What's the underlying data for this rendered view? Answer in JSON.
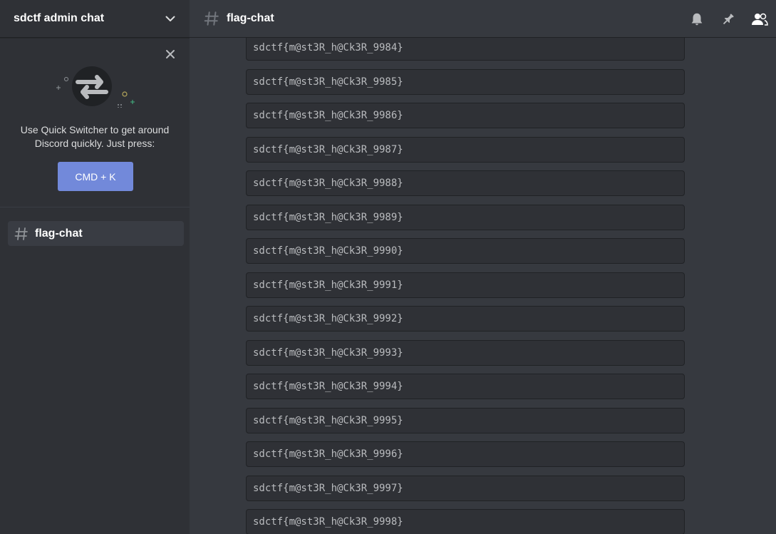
{
  "server": {
    "name": "sdctf admin chat"
  },
  "quick_switcher": {
    "line1": "Use Quick Switcher to get around",
    "line2": "Discord quickly. Just press:",
    "button_label": "CMD + K"
  },
  "channels": [
    {
      "name": "flag-chat",
      "selected": true
    }
  ],
  "header": {
    "channel_name": "flag-chat",
    "icons": [
      "bell-icon",
      "pin-icon",
      "members-icon"
    ]
  },
  "messages": [
    "sdctf{m@st3R_h@Ck3R_9984}",
    "sdctf{m@st3R_h@Ck3R_9985}",
    "sdctf{m@st3R_h@Ck3R_9986}",
    "sdctf{m@st3R_h@Ck3R_9987}",
    "sdctf{m@st3R_h@Ck3R_9988}",
    "sdctf{m@st3R_h@Ck3R_9989}",
    "sdctf{m@st3R_h@Ck3R_9990}",
    "sdctf{m@st3R_h@Ck3R_9991}",
    "sdctf{m@st3R_h@Ck3R_9992}",
    "sdctf{m@st3R_h@Ck3R_9993}",
    "sdctf{m@st3R_h@Ck3R_9994}",
    "sdctf{m@st3R_h@Ck3R_9995}",
    "sdctf{m@st3R_h@Ck3R_9996}",
    "sdctf{m@st3R_h@Ck3R_9997}",
    "sdctf{m@st3R_h@Ck3R_9998}"
  ],
  "colors": {
    "accent": "#7289da",
    "sidebar_bg": "#2f3136",
    "chat_bg": "#36393f"
  }
}
